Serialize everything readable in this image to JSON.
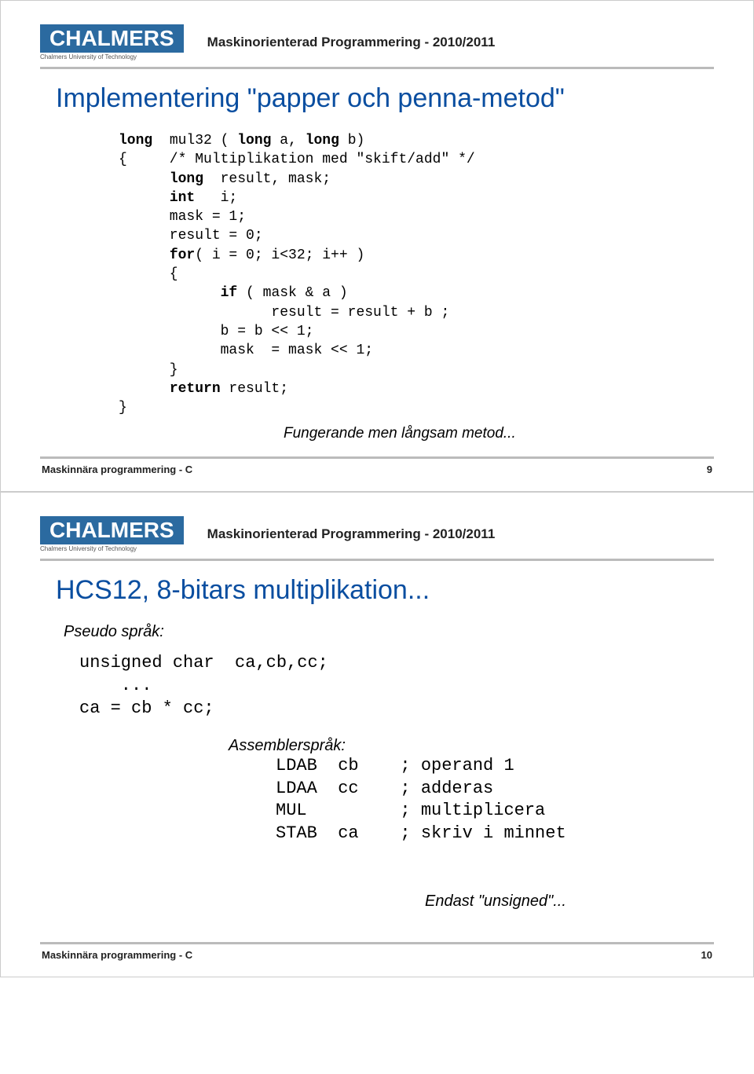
{
  "common": {
    "logo_text": "CHALMERS",
    "logo_sub": "Chalmers University of Technology",
    "course_title": "Maskinorienterad Programmering - 2010/2011",
    "footer_left": "Maskinnära programmering - C"
  },
  "slide1": {
    "title": "Implementering \"papper och penna-metod\"",
    "code_kw_long": "long",
    "code_l1_rest": "  mul32 ( ",
    "code_kw_long2": "long",
    "code_l1_rest2": " a, ",
    "code_kw_long3": "long",
    "code_l1_rest3": " b)",
    "code_l2": "{     /* Multiplikation med \"skift/add\" */",
    "code_l3_pre": "      ",
    "code_l3_rest": "  result, mask;",
    "code_l4_pre": "      ",
    "code_kw_int": "int",
    "code_l4_rest": "   i;",
    "code_l5": "      mask = 1;",
    "code_l6": "      result = 0;",
    "code_l7_pre": "      ",
    "code_kw_for": "for",
    "code_l7_rest": "( i = 0; i<32; i++ )",
    "code_l8": "      {",
    "code_l9_pre": "            ",
    "code_kw_if": "if",
    "code_l9_rest": " ( mask & a )",
    "code_l10": "                  result = result + b ;",
    "code_l11": "            b = b << 1;",
    "code_l12": "            mask  = mask << 1;",
    "code_l13": "      }",
    "code_l14_pre": "      ",
    "code_kw_return": "return",
    "code_l14_rest": " result;",
    "code_l15": "}",
    "note": "Fungerande men långsam metod...",
    "page_no": "9"
  },
  "slide2": {
    "title": "HCS12, 8-bitars multiplikation...",
    "pseudo_label": "Pseudo språk:",
    "pseudo_l1": "unsigned char  ca,cb,cc;",
    "pseudo_l2": "    ...",
    "pseudo_l3": "ca = cb * cc;",
    "asm_label": "Assemblerspråk:",
    "asm_l1": "LDAB  cb    ; operand 1",
    "asm_l2": "LDAA  cc    ; adderas",
    "asm_l3": "MUL         ; multiplicera",
    "asm_l4": "STAB  ca    ; skriv i minnet",
    "end_note": "Endast \"unsigned\"...",
    "page_no": "10"
  }
}
